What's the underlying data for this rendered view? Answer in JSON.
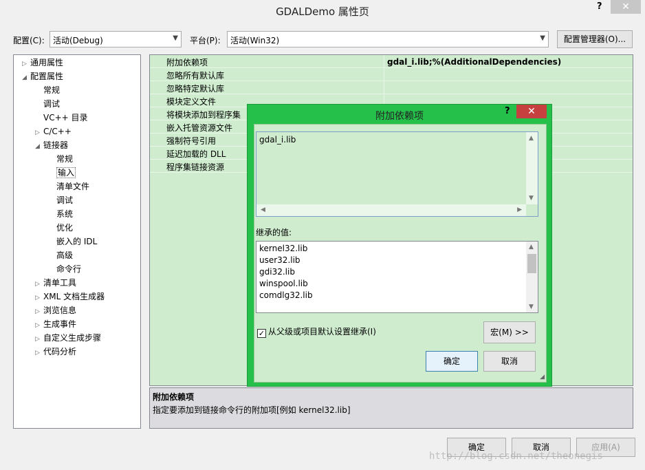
{
  "window": {
    "title": "GDALDemo 属性页",
    "help": "?",
    "close": "✕"
  },
  "config": {
    "label": "配置(C):",
    "value": "活动(Debug)",
    "platform_label": "平台(P):",
    "platform_value": "活动(Win32)",
    "manager_button": "配置管理器(O)..."
  },
  "tree": [
    {
      "label": "通用属性",
      "twisty": "▷"
    },
    {
      "label": "配置属性",
      "twisty": "◢"
    },
    {
      "label": "常规",
      "twisty": ""
    },
    {
      "label": "调试",
      "twisty": ""
    },
    {
      "label": "VC++ 目录",
      "twisty": ""
    },
    {
      "label": "C/C++",
      "twisty": "▷"
    },
    {
      "label": "链接器",
      "twisty": "◢"
    },
    {
      "label": "常规",
      "twisty": ""
    },
    {
      "label": "输入",
      "twisty": ""
    },
    {
      "label": "清单文件",
      "twisty": ""
    },
    {
      "label": "调试",
      "twisty": ""
    },
    {
      "label": "系统",
      "twisty": ""
    },
    {
      "label": "优化",
      "twisty": ""
    },
    {
      "label": "嵌入的 IDL",
      "twisty": ""
    },
    {
      "label": "高级",
      "twisty": ""
    },
    {
      "label": "命令行",
      "twisty": ""
    },
    {
      "label": "清单工具",
      "twisty": "▷"
    },
    {
      "label": "XML 文档生成器",
      "twisty": "▷"
    },
    {
      "label": "浏览信息",
      "twisty": "▷"
    },
    {
      "label": "生成事件",
      "twisty": "▷"
    },
    {
      "label": "自定义生成步骤",
      "twisty": "▷"
    },
    {
      "label": "代码分析",
      "twisty": "▷"
    }
  ],
  "properties": [
    {
      "name": "附加依赖项",
      "value": "gdal_i.lib;%(AdditionalDependencies)"
    },
    {
      "name": "忽略所有默认库",
      "value": ""
    },
    {
      "name": "忽略特定默认库",
      "value": ""
    },
    {
      "name": "模块定义文件",
      "value": ""
    },
    {
      "name": "将模块添加到程序集",
      "value": ""
    },
    {
      "name": "嵌入托管资源文件",
      "value": ""
    },
    {
      "name": "强制符号引用",
      "value": ""
    },
    {
      "name": "延迟加载的 DLL",
      "value": ""
    },
    {
      "name": "程序集链接资源",
      "value": ""
    }
  ],
  "description": {
    "title": "附加依赖项",
    "text": "指定要添加到链接命令行的附加项[例如 kernel32.lib]"
  },
  "dialog": {
    "title": "附加依赖项",
    "help": "?",
    "close": "✕",
    "edit_text": "gdal_i.lib",
    "inherited_label": "继承的值:",
    "inherited": [
      "kernel32.lib",
      "user32.lib",
      "gdi32.lib",
      "winspool.lib",
      "comdlg32.lib"
    ],
    "inherit_checkbox": "从父级或项目默认设置继承(I)",
    "inherit_checked": true,
    "macro_button": "宏(M) >>",
    "ok_button": "确定",
    "cancel_button": "取消"
  },
  "footer": {
    "ok": "确定",
    "cancel": "取消",
    "apply": "应用(A)"
  },
  "watermark": "http://blog.csdn.net/theonegis"
}
